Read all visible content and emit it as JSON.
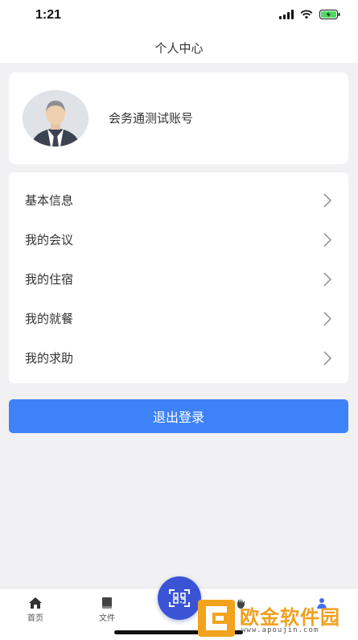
{
  "status_bar": {
    "time": "1:21"
  },
  "nav": {
    "title": "个人中心"
  },
  "profile": {
    "name": "会务通测试账号"
  },
  "menu": {
    "items": [
      {
        "label": "基本信息"
      },
      {
        "label": "我的会议"
      },
      {
        "label": "我的住宿"
      },
      {
        "label": "我的就餐"
      },
      {
        "label": "我的求助"
      }
    ]
  },
  "logout": {
    "label": "退出登录"
  },
  "tabbar": {
    "items": [
      {
        "label": "首页",
        "icon": "home-icon"
      },
      {
        "label": "文件",
        "icon": "book-icon"
      },
      {
        "label": "",
        "icon": "hand-icon"
      },
      {
        "label": "",
        "icon": "person-icon"
      }
    ],
    "scan_icon": "qr-scan-icon"
  },
  "watermark": {
    "text": "欧金软件园",
    "sub": "www.apoujin.com"
  },
  "colors": {
    "accent": "#3e82f7",
    "scan": "#3b54d6",
    "watermark": "#f0a020"
  }
}
